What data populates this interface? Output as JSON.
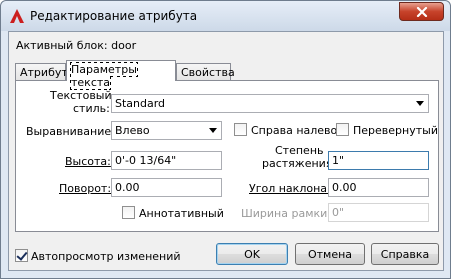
{
  "window": {
    "title": "Редактирование атрибута"
  },
  "block_label": "Активный блок: door",
  "tabs": [
    {
      "label": "Атрибут",
      "active": false
    },
    {
      "label": "Параметры текста",
      "active": true
    },
    {
      "label": "Свойства",
      "active": false
    }
  ],
  "text_options": {
    "text_style_label_line1": "Текстовый",
    "text_style_label_line2": "стиль:",
    "text_style_value": "Standard",
    "justify_label": "Выравнивание:",
    "justify_value": "Влево",
    "backwards_label": "Справа налево",
    "backwards_checked": false,
    "upside_down_label": "Перевернутый",
    "upside_down_checked": false,
    "height_label": "Высота:",
    "height_value": "0'-0 13/64\"",
    "width_factor_label_line1": "Степень",
    "width_factor_label_line2": "растяжения:",
    "width_factor_value": "1\"",
    "rotation_label": "Поворот:",
    "rotation_value": "0.00",
    "oblique_label": "Угол наклона:",
    "oblique_value": "0.00",
    "annotative_label": "Аннотативный",
    "annotative_checked": false,
    "boundary_width_label": "Ширина рамки:",
    "boundary_width_value": "0\""
  },
  "footer": {
    "preview_label": "Автопросмотр изменений",
    "preview_checked": true,
    "ok_label": "OK",
    "cancel_label": "Отмена",
    "help_label": "Справка"
  },
  "colors": {
    "title_gradient_top": "#e6eef8",
    "close_button": "#c7432b",
    "dialog_background": "#f0f0f0",
    "app_icon": "#cc1f1f"
  },
  "icons": {
    "app": "autocad-a-icon",
    "close": "close-icon",
    "dropdown": "chevron-down-icon"
  }
}
